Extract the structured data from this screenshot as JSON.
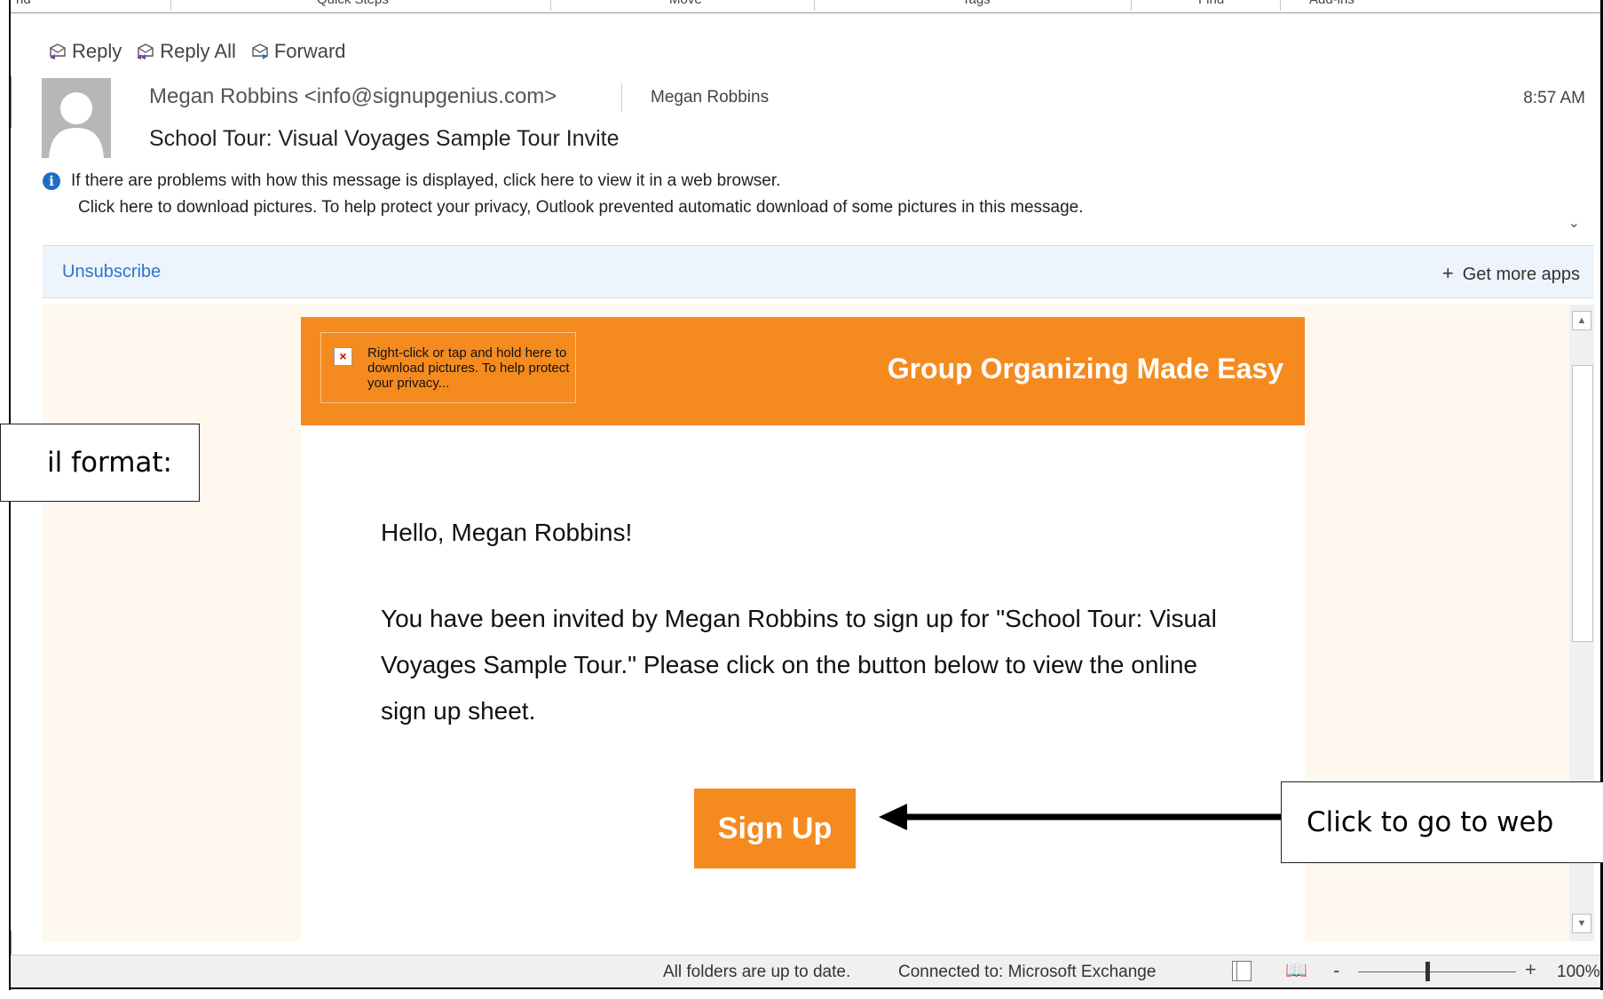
{
  "ribbon": {
    "groups": [
      "nd",
      "Quick Steps",
      "Move",
      "Tags",
      "Find",
      "Add-ins"
    ]
  },
  "actions": {
    "reply": "Reply",
    "reply_all": "Reply All",
    "forward": "Forward"
  },
  "header": {
    "from": "Megan Robbins <info@signupgenius.com>",
    "to": "Megan Robbins",
    "time": "8:57 AM",
    "subject": "School Tour: Visual Voyages Sample Tour Invite"
  },
  "info": {
    "line1": "If there are problems with how this message is displayed, click here to view it in a web browser.",
    "line2": "Click here to download pictures. To help protect your privacy, Outlook prevented automatic download of some pictures in this message."
  },
  "addins": {
    "unsubscribe": "Unsubscribe",
    "get_more_apps": "Get more apps"
  },
  "email": {
    "image_placeholder": "Right-click or tap and hold here to download pictures. To help protect your privacy...",
    "tagline": "Group Organizing Made Easy",
    "greeting": "Hello, Megan Robbins!",
    "paragraph": "You have been invited by Megan Robbins to sign up for \"School Tour: Visual Voyages Sample Tour.\" Please click on the button below to view the online sign up sheet.",
    "button": "Sign Up",
    "brand_color": "#f58a1f"
  },
  "status": {
    "folders": "All folders are up to date.",
    "connection": "Connected to: Microsoft Exchange",
    "zoom": "100%"
  },
  "annotations": {
    "left_callout": "il format:",
    "right_callout": "Click to go to web"
  }
}
